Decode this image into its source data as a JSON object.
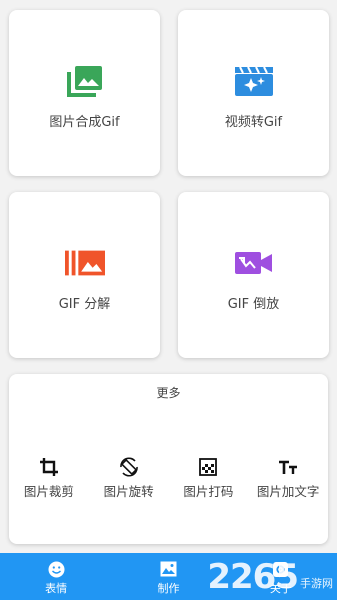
{
  "tiles": [
    {
      "label": "图片合成Gif",
      "icon": "photo-library-icon",
      "color": "#3aa659"
    },
    {
      "label": "视频转Gif",
      "icon": "movie-sparkle-icon",
      "color": "#2d8ddf"
    },
    {
      "label": "GIF 分解",
      "icon": "burst-photo-icon",
      "color": "#f0542a"
    },
    {
      "label": "GIF 倒放",
      "icon": "video-reverse-icon",
      "color": "#9f4fe0"
    }
  ],
  "more": {
    "title": "更多",
    "tools": [
      {
        "label": "图片裁剪",
        "icon": "crop-icon"
      },
      {
        "label": "图片旋转",
        "icon": "rotate-icon"
      },
      {
        "label": "图片打码",
        "icon": "mosaic-icon"
      },
      {
        "label": "图片加文字",
        "icon": "text-icon"
      }
    ]
  },
  "nav": [
    {
      "label": "表情",
      "icon": "emoji-icon"
    },
    {
      "label": "制作",
      "icon": "image-icon"
    },
    {
      "label": "关于",
      "icon": "settings-icon"
    }
  ],
  "watermark": {
    "number": "2265",
    "site": "手游网"
  }
}
